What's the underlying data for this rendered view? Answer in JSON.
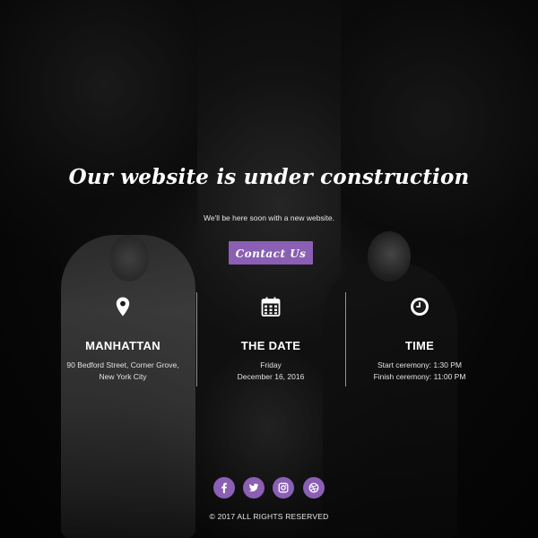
{
  "hero": {
    "headline": "Our website is under construction",
    "subline": "We'll be here soon with a new website.",
    "contact_label": "Contact Us"
  },
  "info": [
    {
      "icon": "map-pin-icon",
      "title": "MANHATTAN",
      "lines": [
        "90 Bedford Street, Corner Grove,",
        "New York City"
      ]
    },
    {
      "icon": "calendar-icon",
      "title": "THE DATE",
      "lines": [
        "Friday",
        "December 16, 2016"
      ]
    },
    {
      "icon": "clock-icon",
      "title": "TIME",
      "lines": [
        "Start ceremony: 1:30 PM",
        "Finish ceremony: 11:00 PM"
      ]
    }
  ],
  "social": [
    {
      "icon": "facebook-icon"
    },
    {
      "icon": "twitter-icon"
    },
    {
      "icon": "instagram-icon"
    },
    {
      "icon": "dribbble-icon"
    }
  ],
  "footer": {
    "copyright": "© 2017 ALL RIGHTS RESERVED"
  },
  "colors": {
    "accent": "#8a5fb4",
    "text": "#ffffff",
    "background": "#0a0a0a"
  }
}
